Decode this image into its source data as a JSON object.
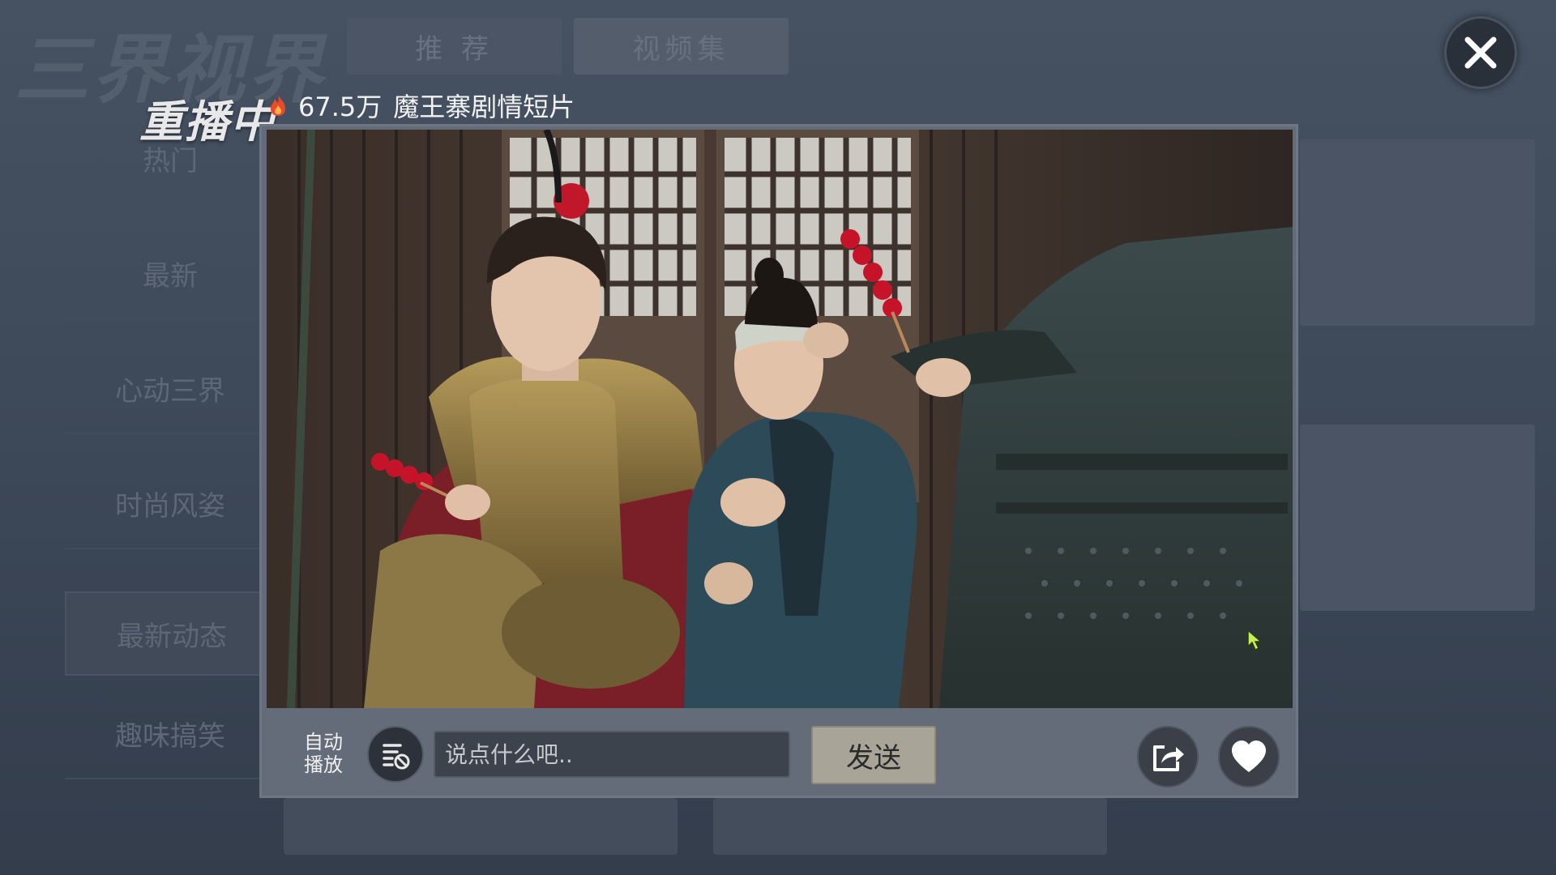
{
  "app": {
    "logo": "三界视界"
  },
  "top_tabs": [
    "推 荐",
    "视频集"
  ],
  "sidebar": {
    "items": [
      "热门",
      "最新",
      "心动三界",
      "时尚风姿",
      "最新动态",
      "趣味搞笑"
    ],
    "selected": "最新动态"
  },
  "player": {
    "replay_label": "重播中",
    "views": "67.5万",
    "title": "魔王寨剧情短片",
    "autoplay_label": "自动播放",
    "comment_placeholder": "说点什么吧..",
    "send_label": "发送"
  },
  "icons": {
    "close": "close-icon",
    "flame": "flame-icon",
    "danmaku": "danmaku-toggle-icon",
    "share": "share-icon",
    "like": "heart-icon"
  },
  "colors": {
    "accent": "#a8a498",
    "background": "#3c4656"
  }
}
